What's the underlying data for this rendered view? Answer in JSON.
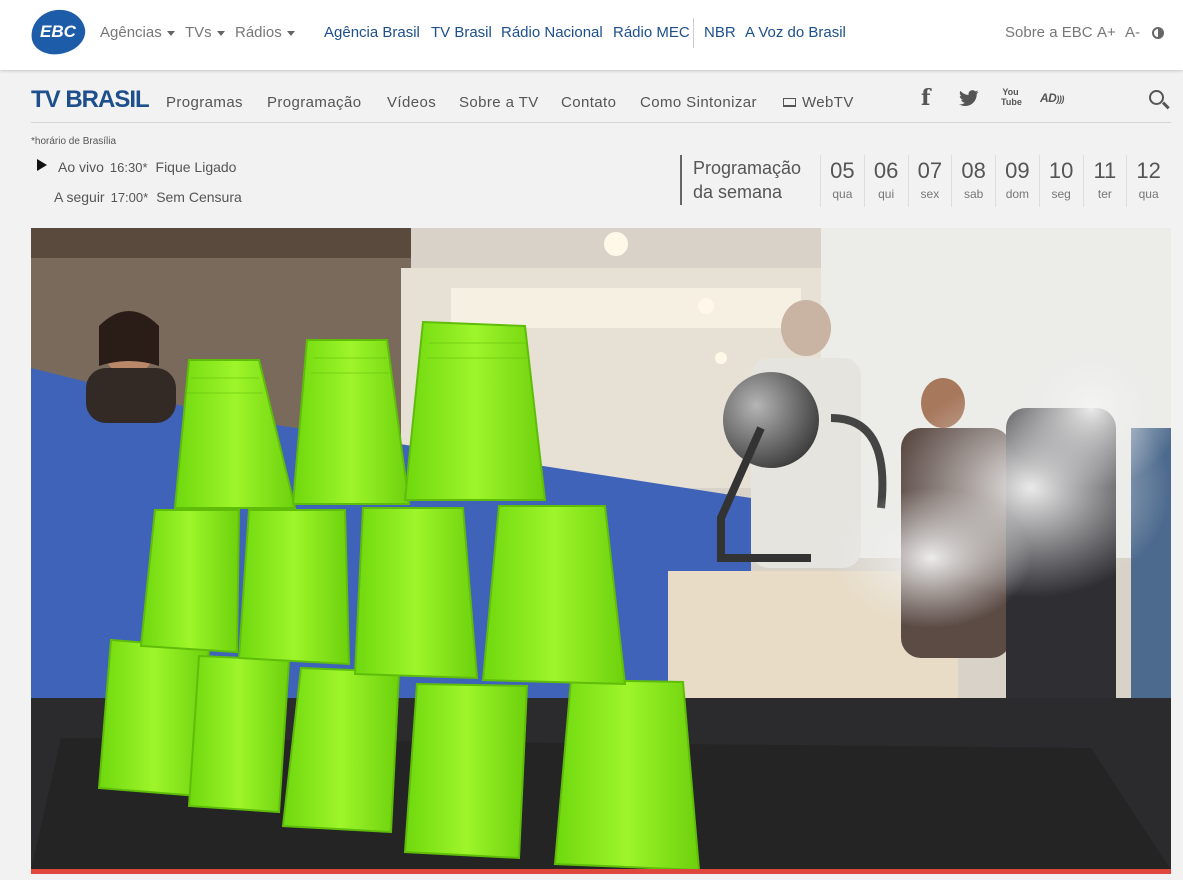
{
  "ebc_bar": {
    "logo_text": "EBC",
    "dropdowns": [
      "Agências",
      "TVs",
      "Rádios"
    ],
    "links": [
      "Agência Brasil",
      "TV Brasil",
      "Rádio Nacional",
      "Rádio MEC",
      "NBR",
      "A Voz do Brasil"
    ],
    "about": "Sobre a EBC",
    "font_up": "A+",
    "font_down": "A-",
    "contrast_icon": "contrast-icon",
    "colors": {
      "brand_blue": "#1d4f8c",
      "link_blue": "#1d4f8c"
    }
  },
  "tv_nav": {
    "logo_text": "TV BRASIL",
    "items": [
      "Programas",
      "Programação",
      "Vídeos",
      "Sobre a TV",
      "Contato",
      "Como Sintonizar",
      "WebTV"
    ],
    "social": {
      "facebook": "f",
      "twitter": "twitter-icon",
      "youtube": "You Tube",
      "ad": "AD"
    },
    "search_icon": "search-icon"
  },
  "schedule": {
    "tz_note": "*horário de Brasília",
    "live_label": "Ao vivo",
    "live_time": "16:30*",
    "live_show": "Fique Ligado",
    "next_label": "A seguir",
    "next_time": "17:00*",
    "next_show": "Sem Censura",
    "week_title_1": "Programação",
    "week_title_2": "da semana",
    "days": [
      {
        "num": "05",
        "wd": "qua"
      },
      {
        "num": "06",
        "wd": "qui"
      },
      {
        "num": "07",
        "wd": "sex"
      },
      {
        "num": "08",
        "wd": "sab"
      },
      {
        "num": "09",
        "wd": "dom"
      },
      {
        "num": "10",
        "wd": "seg"
      },
      {
        "num": "11",
        "wd": "ter"
      },
      {
        "num": "12",
        "wd": "qua"
      }
    ]
  },
  "video": {
    "progress_color": "#e0473c",
    "cup_color": "#8cf21a"
  }
}
